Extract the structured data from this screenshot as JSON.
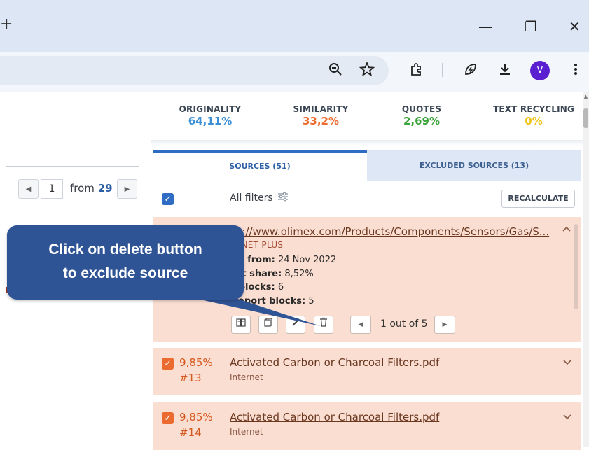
{
  "browser": {
    "new_tab_glyph": "+",
    "window_controls": [
      "—",
      "❐",
      "✕"
    ],
    "avatar_letter": "V"
  },
  "pager": {
    "current_page": "1",
    "from_label": "from",
    "total_pages": "29"
  },
  "metrics": [
    {
      "label": "ORIGINALITY",
      "value": "64,11%",
      "color": "#3b8fd6"
    },
    {
      "label": "SIMILARITY",
      "value": "33,2%",
      "color": "#ec6b2e"
    },
    {
      "label": "QUOTES",
      "value": "2,69%",
      "color": "#3aa33a"
    },
    {
      "label": "TEXT RECYCLING",
      "value": "0%",
      "color": "#f0c419"
    }
  ],
  "tabs": {
    "sources": "SOURCES (51)",
    "excluded": "EXCLUDED SOURCES (13)"
  },
  "filters": {
    "all_filters": "All filters",
    "recalculate": "RECALCULATE"
  },
  "sources": [
    {
      "url_visible": "ps://www.olimex.com/Products/Components/Sensors/Gas/S...",
      "type_visible": "ERNET PLUS",
      "found_label": "nd from:",
      "found_value": "24 Nov 2022",
      "share_label": "ort share:",
      "share_value": "8,52%",
      "blocks_label": "t blocks:",
      "blocks_value": "6",
      "report_blocks_label": "Report blocks:",
      "report_blocks_value": "5",
      "page_info": "1 out of 5"
    },
    {
      "percent": "9,85%",
      "number": "#13",
      "title": "Activated Carbon or Charcoal Filters.pdf",
      "type": "Internet"
    },
    {
      "percent": "9,85%",
      "number": "#14",
      "title": "Activated Carbon or Charcoal Filters.pdf",
      "type": "Internet"
    }
  ],
  "callout": {
    "line1": "Click on delete button",
    "line2": "to exclude source"
  },
  "colors": {
    "accent": "#2f6cc4",
    "callout": "#2f5496",
    "card_bg": "#fbded2"
  }
}
